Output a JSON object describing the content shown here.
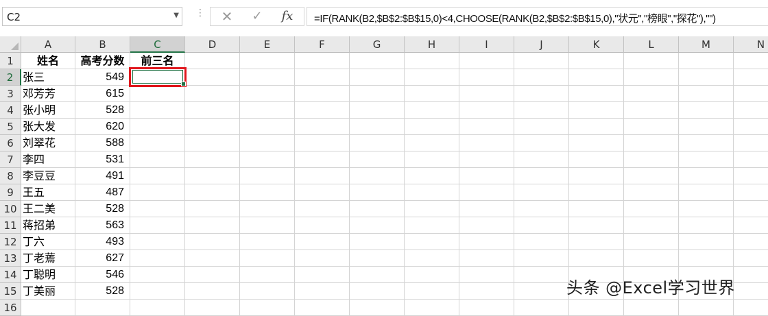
{
  "name_box": {
    "value": "C2"
  },
  "formula_bar": {
    "cancel_glyph": "✕",
    "enter_glyph": "✓",
    "fx_label": "fx",
    "formula": "=IF(RANK(B2,$B$2:$B$15,0)<4,CHOOSE(RANK(B2,$B$2:$B$15,0),\"状元\",\"榜眼\",\"探花\"),\"\")"
  },
  "columns": [
    "A",
    "B",
    "C",
    "D",
    "E",
    "F",
    "G",
    "H",
    "I",
    "J",
    "K",
    "L",
    "M",
    "N"
  ],
  "rows": [
    "1",
    "2",
    "3",
    "4",
    "5",
    "6",
    "7",
    "8",
    "9",
    "10",
    "11",
    "12",
    "13",
    "14",
    "15",
    "16"
  ],
  "headers": {
    "name": "姓名",
    "score": "高考分数",
    "top3": "前三名"
  },
  "data_rows": [
    {
      "name": "张三",
      "score": "549",
      "top3": ""
    },
    {
      "name": "邓芳芳",
      "score": "615",
      "top3": ""
    },
    {
      "name": "张小明",
      "score": "528",
      "top3": ""
    },
    {
      "name": "张大发",
      "score": "620",
      "top3": ""
    },
    {
      "name": "刘翠花",
      "score": "588",
      "top3": ""
    },
    {
      "name": "李四",
      "score": "531",
      "top3": ""
    },
    {
      "name": "李豆豆",
      "score": "491",
      "top3": ""
    },
    {
      "name": "王五",
      "score": "487",
      "top3": ""
    },
    {
      "name": "王二美",
      "score": "528",
      "top3": ""
    },
    {
      "name": "蒋招弟",
      "score": "563",
      "top3": ""
    },
    {
      "name": "丁六",
      "score": "493",
      "top3": ""
    },
    {
      "name": "丁老蔫",
      "score": "627",
      "top3": ""
    },
    {
      "name": "丁聪明",
      "score": "546",
      "top3": ""
    },
    {
      "name": "丁美丽",
      "score": "528",
      "top3": ""
    }
  ],
  "selected_cell": {
    "column": "C",
    "row": "2"
  },
  "watermark": "头条 @Excel学习世界",
  "colors": {
    "selection_accent": "#217346",
    "highlight_box": "#e0161c",
    "header_bg": "#e9e9e9",
    "gridline": "#d4d4d4"
  }
}
